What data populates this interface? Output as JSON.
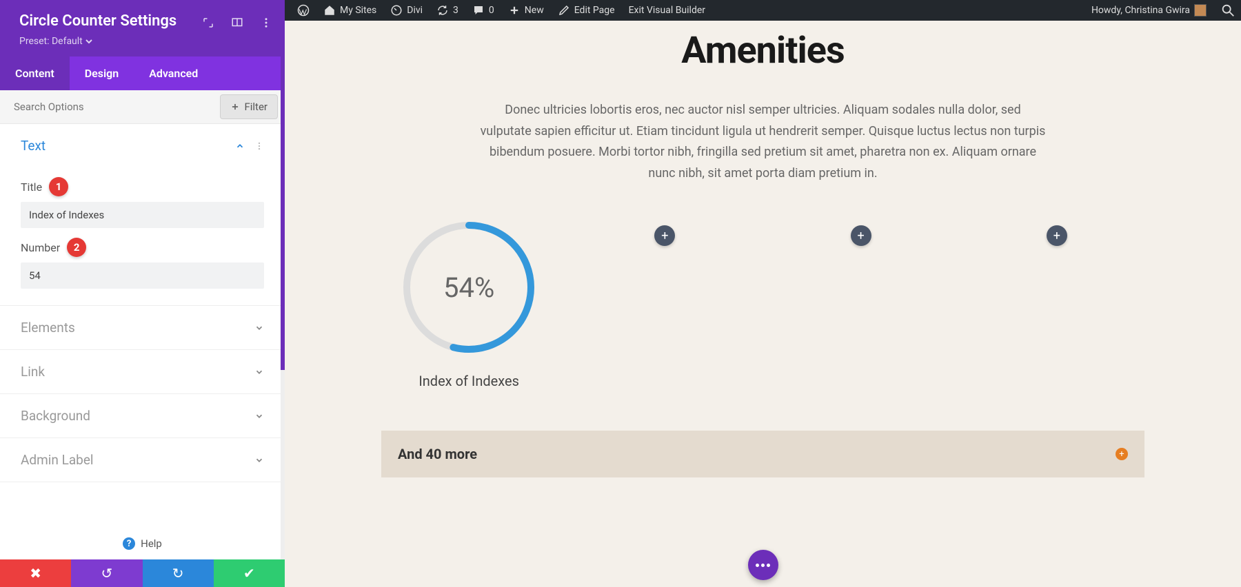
{
  "sidebar": {
    "title": "Circle Counter Settings",
    "preset_label": "Preset: Default",
    "tabs": [
      "Content",
      "Design",
      "Advanced"
    ],
    "search_placeholder": "Search Options",
    "filter_label": "Filter",
    "text_section": {
      "title": "Text",
      "title_label": "Title",
      "title_value": "Index of Indexes",
      "number_label": "Number",
      "number_value": "54",
      "badge1": "1",
      "badge2": "2"
    },
    "collapsed_sections": [
      "Elements",
      "Link",
      "Background",
      "Admin Label"
    ],
    "help_label": "Help"
  },
  "adminbar": {
    "my_sites": "My Sites",
    "divi": "Divi",
    "updates_count": "3",
    "comments_count": "0",
    "new": "New",
    "edit_page": "Edit Page",
    "exit_vb": "Exit Visual Builder",
    "howdy": "Howdy, Christina Gwira"
  },
  "page": {
    "heading": "Amenities",
    "desc": "Donec ultricies lobortis eros, nec auctor nisl semper ultricies. Aliquam sodales nulla dolor, sed vulputate sapien efficitur ut. Etiam tincidunt ligula ut hendrerit semper. Quisque luctus lectus non turpis bibendum posuere. Morbi tortor nibh, fringilla sed pretium sit amet, pharetra non ex. Aliquam ornare nunc nibh, sit amet porta diam pretium in.",
    "counter_percent": "54%",
    "counter_title": "Index of Indexes",
    "more_text": "And 40 more"
  }
}
